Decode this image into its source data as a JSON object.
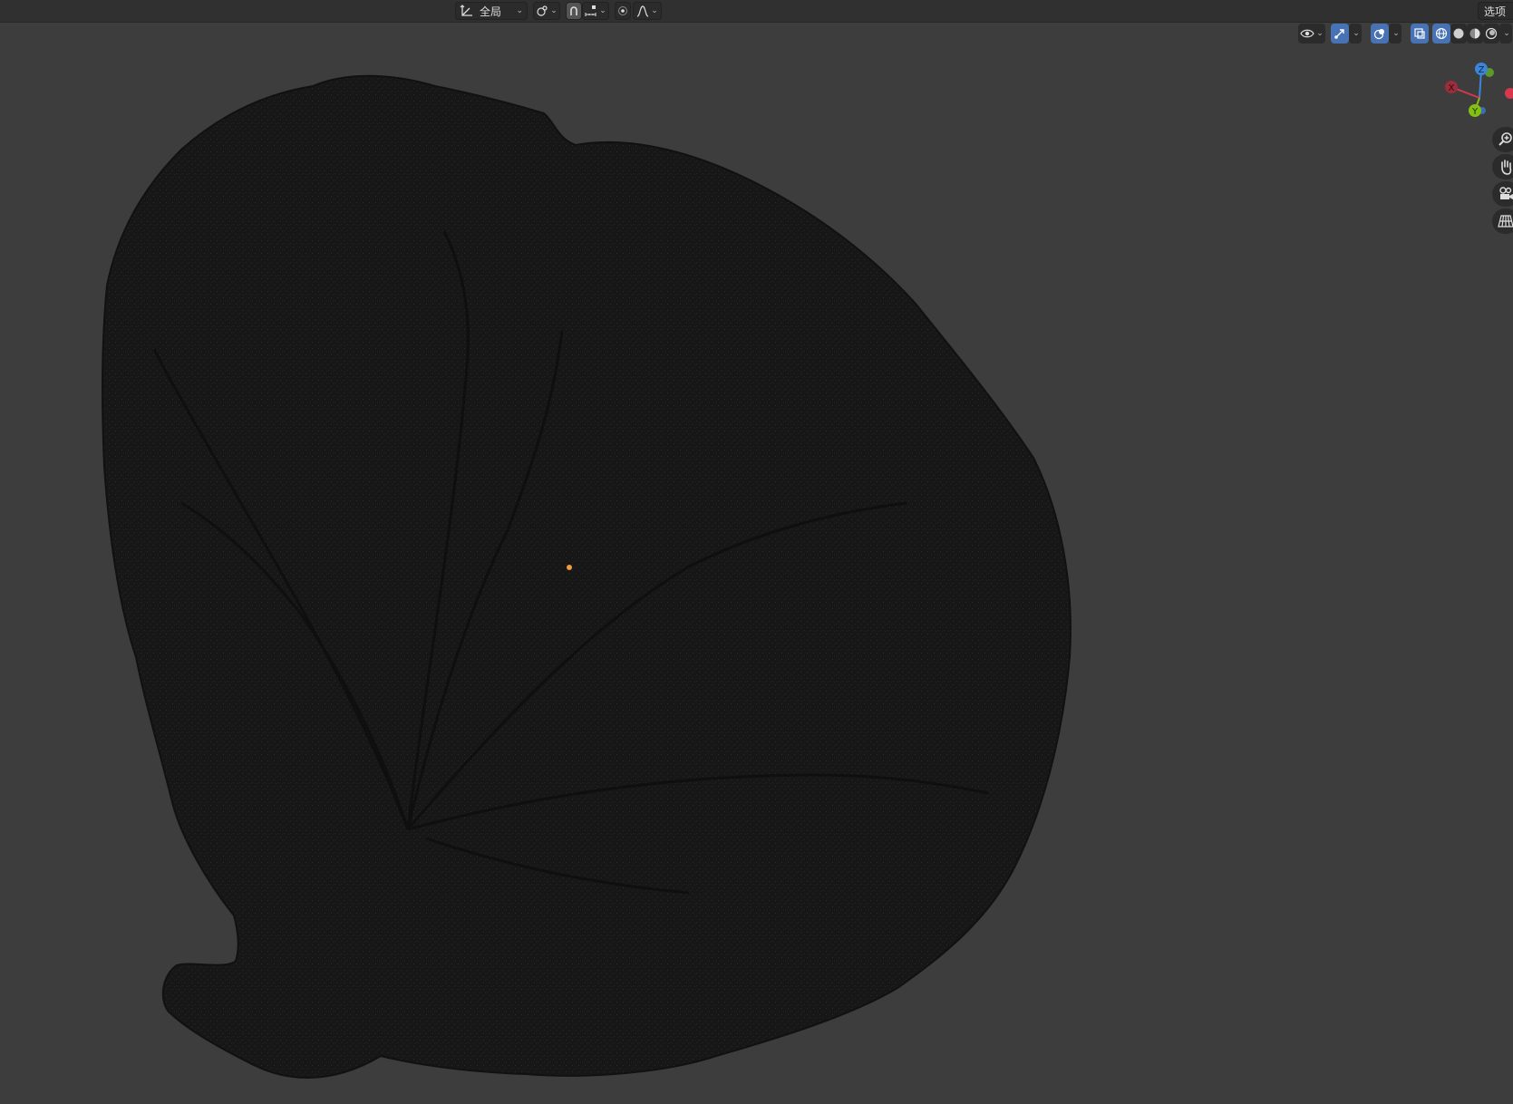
{
  "header": {
    "transform_orientation": {
      "label": "全局",
      "icon": "transform-orientation-icon"
    },
    "pivot": {
      "icon": "pivot-point-icon"
    },
    "snap": {
      "icon": "snap-icon",
      "increment_icon": "snap-increment-icon"
    },
    "proportional": {
      "icon": "proportional-editing-icon",
      "falloff_icon": "smooth-falloff-icon"
    },
    "options_label": "选项"
  },
  "viewport": {
    "overlay_icons": [
      "eye-icon",
      "gizmo-icon",
      "overlays-icon",
      "xray-icon",
      "wireframe-shading-icon",
      "solid-shading-icon",
      "material-shading-icon",
      "rendered-shading-icon"
    ],
    "axes": {
      "z": "Z",
      "x": "X",
      "y": "Y"
    },
    "nav_icons": [
      "zoom-icon",
      "pan-hand-icon",
      "camera-icon",
      "ortho-grid-icon"
    ],
    "colors": {
      "background": "#3d3d3d",
      "mesh": "#181818",
      "origin": "#f29d3d",
      "x_axis": "#d8384d",
      "y_axis": "#84c013",
      "z_axis": "#3b85d9"
    }
  }
}
